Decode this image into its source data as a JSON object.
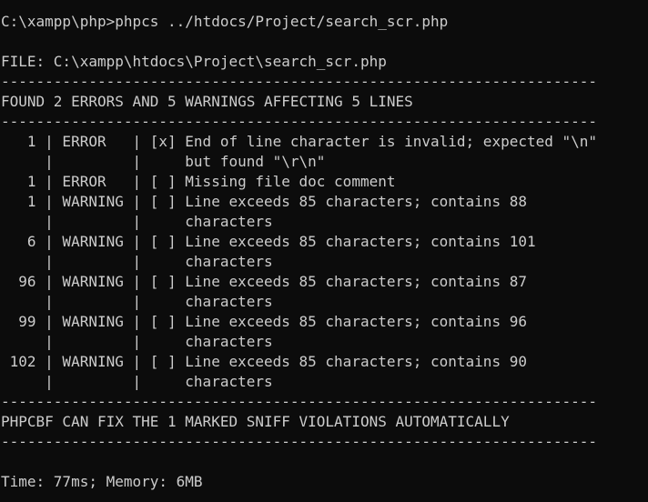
{
  "terminal": {
    "prompt": "C:\\xampp\\php>",
    "command": "phpcs ../htdocs/Project/search_scr.php",
    "file_line": "FILE: C:\\xampp\\htdocs\\Project\\search_scr.php",
    "separator": "--------------------------------------------------------------------",
    "summary": "FOUND 2 ERRORS AND 5 WARNINGS AFFECTING 5 LINES",
    "report_rows": [
      "   1 | ERROR   | [x] End of line character is invalid; expected \"\\n\"",
      "     |         |     but found \"\\r\\n\"",
      "   1 | ERROR   | [ ] Missing file doc comment",
      "   1 | WARNING | [ ] Line exceeds 85 characters; contains 88",
      "     |         |     characters",
      "   6 | WARNING | [ ] Line exceeds 85 characters; contains 101",
      "     |         |     characters",
      "  96 | WARNING | [ ] Line exceeds 85 characters; contains 87",
      "     |         |     characters",
      "  99 | WARNING | [ ] Line exceeds 85 characters; contains 96",
      "     |         |     characters",
      " 102 | WARNING | [ ] Line exceeds 85 characters; contains 90",
      "     |         |     characters"
    ],
    "fix_message": "PHPCBF CAN FIX THE 1 MARKED SNIFF VIOLATIONS AUTOMATICALLY",
    "timing": "Time: 77ms; Memory: 6MB"
  },
  "colors": {
    "background": "#0c0c0c",
    "foreground": "#cccccc"
  }
}
